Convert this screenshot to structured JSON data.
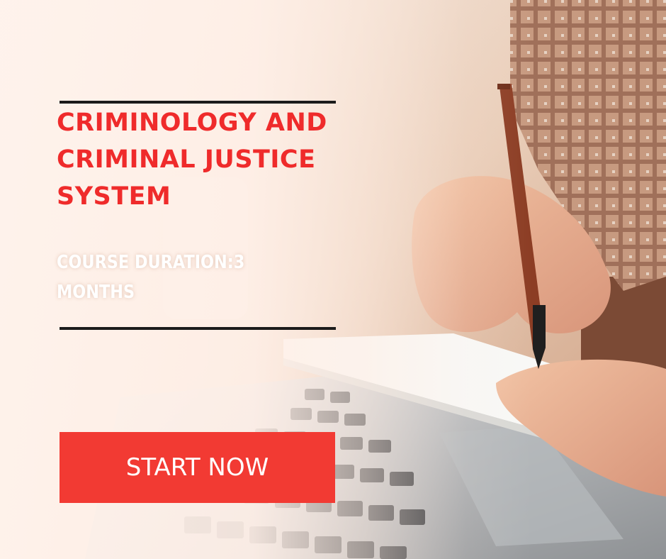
{
  "ad": {
    "title": "CRIMINOLOGY AND CRIMINAL JUSTICE SYSTEM",
    "duration": "COURSE DURATION:3 MONTHS",
    "cta_label": "START NOW"
  },
  "colors": {
    "title": "#ef2b2b",
    "duration_text": "#ffffff",
    "cta_background": "#f23a33",
    "cta_text": "#ffffff",
    "rules": "#1b1b1b"
  },
  "photo": {
    "subject": "hand writing in notebook with pen beside laptop keyboard"
  }
}
